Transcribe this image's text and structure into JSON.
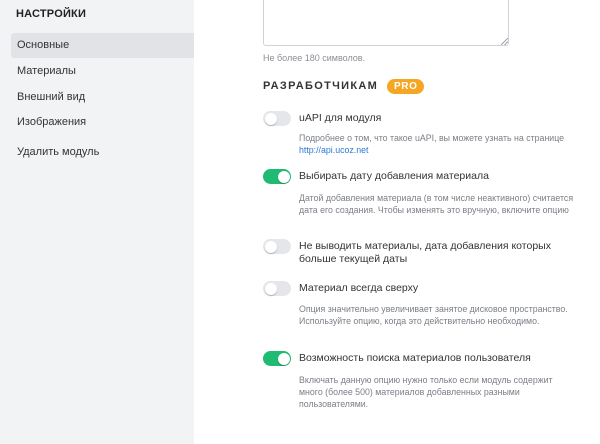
{
  "sidebar": {
    "title": "НАСТРОЙКИ",
    "items": [
      {
        "label": "Основные"
      },
      {
        "label": "Материалы"
      },
      {
        "label": "Внешний вид"
      },
      {
        "label": "Изображения"
      },
      {
        "label": "Удалить модуль"
      }
    ]
  },
  "main": {
    "textarea_value": "",
    "textarea_hint": "Не более 180 символов.",
    "section_title": "РАЗРАБОТЧИКАМ",
    "pro_badge": "PRO",
    "options": [
      {
        "label": "uAPI для модуля",
        "enabled": false,
        "desc_prefix": "Подробнее о том, что такое uAPI, вы можете узнать на странице",
        "desc_link": "http://api.ucoz.net"
      },
      {
        "label": "Выбирать дату добавления материала",
        "enabled": true,
        "desc": "Датой добавления материала (в том числе неактивного) считается дата его создания. Чтобы изменять это вручную, включите опцию"
      },
      {
        "label": "Не выводить материалы, дата добавления которых больше текущей даты",
        "enabled": false
      },
      {
        "label": "Материал всегда сверху",
        "enabled": false,
        "desc": "Опция значительно увеличивает занятое дисковое пространство. Используйте опцию, когда это действительно необходимо."
      },
      {
        "label": "Возможность поиска материалов пользователя",
        "enabled": true,
        "desc": "Включать данную опцию нужно только если модуль содержит много (более 500) материалов добавленных разными пользователями."
      }
    ]
  },
  "colors": {
    "toggle_on": "#1fbb72",
    "toggle_off": "#e4e6e9",
    "pro_badge": "#f5a623",
    "link": "#2b7bd1"
  }
}
